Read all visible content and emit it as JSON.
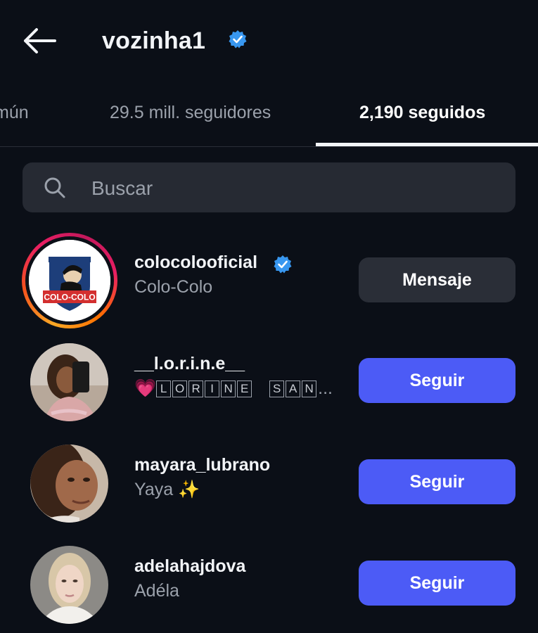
{
  "header": {
    "title": "vozinha1"
  },
  "tabs": [
    {
      "label": "mún"
    },
    {
      "label": "29.5 mill. seguidores"
    },
    {
      "label": "2,190 seguidos"
    }
  ],
  "search": {
    "placeholder": "Buscar"
  },
  "list": [
    {
      "username": "colocolooficial",
      "display_name": "Colo-Colo",
      "verified": true,
      "action": "Mensaje",
      "avatar_text": "COLO-COLO"
    },
    {
      "username": "__l.o.r.i.n.e__",
      "display_name_prefix": "💗",
      "display_name_boxed": [
        "L",
        "O",
        "R",
        "I",
        "N",
        "E",
        " ",
        "S",
        "A",
        "N"
      ],
      "display_name_suffix": "...",
      "action": "Seguir"
    },
    {
      "username": "mayara_lubrano",
      "display_name": "Yaya ✨",
      "action": "Seguir"
    },
    {
      "username": "adelahajdova",
      "display_name": "Adéla",
      "action": "Seguir"
    }
  ],
  "colors": {
    "background": "#0b0f17",
    "follow_button": "#4c5bf6",
    "message_button": "#2a2e37",
    "verified": "#3897f0"
  }
}
